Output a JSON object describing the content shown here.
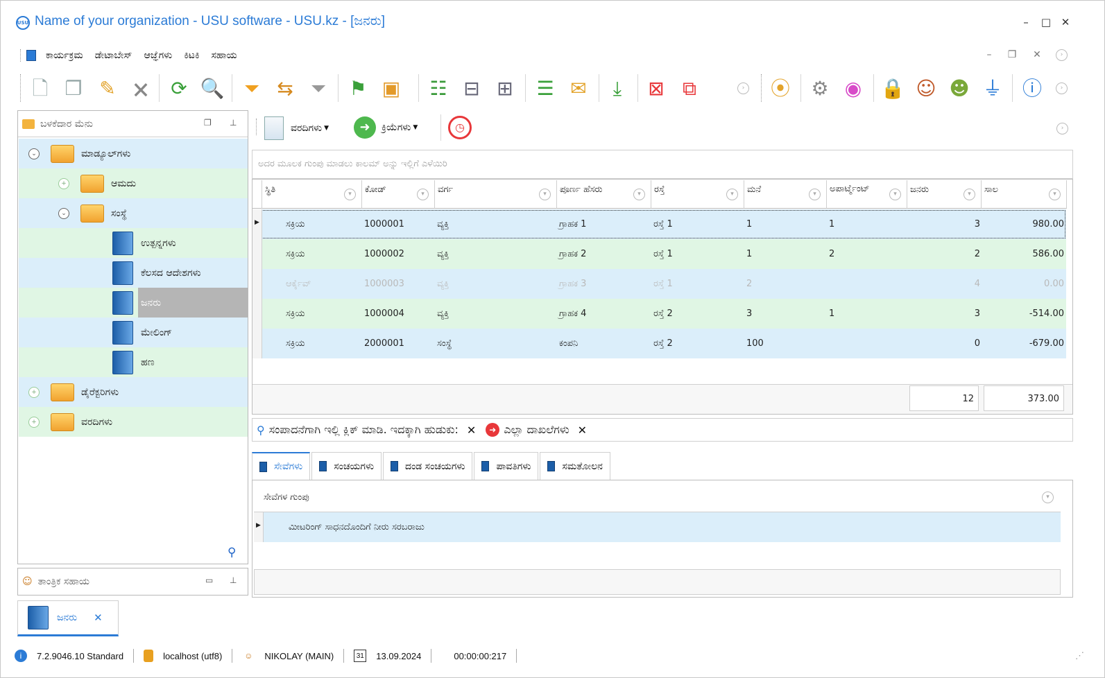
{
  "window": {
    "logo_text": "USU",
    "title": "Name of your organization - USU software - USU.kz - [ಜನರು]",
    "controls": [
      "–",
      "□",
      "✕"
    ]
  },
  "menu": {
    "items": [
      "ಕಾರ್ಯಕ್ರಮ",
      "ಡೇಟಾಬೇಸ್",
      "ಆಜ್ಞೆಗಳು",
      "ಕಿಟಕಿ",
      "ಸಹಾಯ"
    ]
  },
  "toolbar": {
    "icons": [
      "add-icon",
      "copy-icon",
      "edit-icon",
      "delete-icon",
      "refresh-icon",
      "search-icon",
      "filter-icon",
      "filter-field-icon",
      "clear-filter-icon",
      "flag-icon",
      "image-icon",
      "expand-icon",
      "sort-asc-icon",
      "sort-desc-icon",
      "add-row-icon",
      "notes-icon",
      "download-icon",
      "close-window-icon",
      "close-all-icon",
      "location-icon",
      "settings-icon",
      "color-icon",
      "lock-icon",
      "user-key-icon",
      "users-icon",
      "plug-icon",
      "info-icon"
    ]
  },
  "left_panel": {
    "title": "ಬಳಕೆದಾರ ಮೆನು",
    "tree": [
      {
        "label": "ಮಾಡ್ಯೂಲ್‌ಗಳು"
      },
      {
        "label": "ಆಮದು"
      },
      {
        "label": "ಸಂಸ್ಥೆ"
      },
      {
        "label": "ಉತ್ಪನ್ನಗಳು"
      },
      {
        "label": "ಕೆಲಸದ ಆದೇಶಗಳು"
      },
      {
        "label": "ಜನರು"
      },
      {
        "label": "ಮೇಲಿಂಗ್"
      },
      {
        "label": "ಹಣ"
      },
      {
        "label": "ಡೈರೆಕ್ಟರಿಗಳು"
      },
      {
        "label": "ವರದಿಗಳು"
      }
    ],
    "bottom_title": "ತಾಂತ್ರಿಕ ಸಹಾಯ"
  },
  "right_toolbar": {
    "reports": "ವರದಿಗಳು",
    "actions": "ಕ್ರಿಯೆಗಳು"
  },
  "group_hint": "ಅದರ ಮೂಲಕ ಗುಂಪು ಮಾಡಲು ಕಾಲಮ್ ಅನ್ನು ಇಲ್ಲಿಗೆ ಎಳೆಯಿರಿ",
  "grid": {
    "columns": [
      "ಸ್ಥಿತಿ",
      "ಕೋಡ್",
      "ವರ್ಗ",
      "ಪೂರ್ಣ ಹೆಸರು",
      "ರಸ್ತೆ",
      "ಮನೆ",
      "ಅಪಾರ್ಟ್ಮೆಂಟ್",
      "ಜನರು",
      "ಸಾಲ"
    ],
    "rows": [
      {
        "status": "ಸಕ್ರಿಯ",
        "code": "1000001",
        "category": "ವ್ಯಕ್ತಿ",
        "name": "ಗ್ರಾಹಕ 1",
        "street": "ರಸ್ತೆ 1",
        "house": "1",
        "apartment": "1",
        "people": "3",
        "debt": "980.00"
      },
      {
        "status": "ಸಕ್ರಿಯ",
        "code": "1000002",
        "category": "ವ್ಯಕ್ತಿ",
        "name": "ಗ್ರಾಹಕ 2",
        "street": "ರಸ್ತೆ 1",
        "house": "1",
        "apartment": "2",
        "people": "2",
        "debt": "586.00"
      },
      {
        "status": "ಆರ್ಕೈವ್",
        "code": "1000003",
        "category": "ವ್ಯಕ್ತಿ",
        "name": "ಗ್ರಾಹಕ 3",
        "street": "ರಸ್ತೆ 1",
        "house": "2",
        "apartment": "",
        "people": "4",
        "debt": "0.00"
      },
      {
        "status": "ಸಕ್ರಿಯ",
        "code": "1000004",
        "category": "ವ್ಯಕ್ತಿ",
        "name": "ಗ್ರಾಹಕ 4",
        "street": "ರಸ್ತೆ 2",
        "house": "3",
        "apartment": "1",
        "people": "3",
        "debt": "-514.00"
      },
      {
        "status": "ಸಕ್ರಿಯ",
        "code": "2000001",
        "category": "ಸಂಸ್ಥೆ",
        "name": "ಕಂಪನಿ",
        "street": "ರಸ್ತೆ 2",
        "house": "100",
        "apartment": "",
        "people": "0",
        "debt": "-679.00"
      }
    ],
    "totals": {
      "people": "12",
      "debt": "373.00"
    }
  },
  "find_bar": {
    "text": "ಸಂಪಾದನೆಗಾಗಿ ಇಲ್ಲಿ ಕ್ಲಿಕ್ ಮಾಡಿ. ಇದಕ್ಕಾಗಿ ಹುಡುಕು:",
    "filter": "ಎಲ್ಲಾ ದಾಖಲೆಗಳು"
  },
  "tabs": [
    "ಸೇವೆಗಳು",
    "ಸಂಚಯಗಳು",
    "ದಂಡ ಸಂಚಯಗಳು",
    "ಪಾವತಿಗಳು",
    "ಸಮತೋಲನ"
  ],
  "subgrid": {
    "column": "ಸೇವೆಗಳ ಗುಂಪು",
    "rows": [
      "ಮೀಟರಿಂಗ್ ಸಾಧನದೊಂದಿಗೆ ನೀರು ಸರಬರಾಜು"
    ]
  },
  "doc_tab": {
    "label": "ಜನರು"
  },
  "status": {
    "version": "7.2.9046.10 Standard",
    "db": "localhost (utf8)",
    "user": "NIKOLAY (MAIN)",
    "calendar_day": "31",
    "date": "13.09.2024",
    "timer": "00:00:00:217"
  },
  "colors": {
    "accent": "#2b7bd6",
    "row_blue": "#dbeefa",
    "row_green": "#e0f6e4",
    "selected_tree": "#b5b5b5"
  }
}
